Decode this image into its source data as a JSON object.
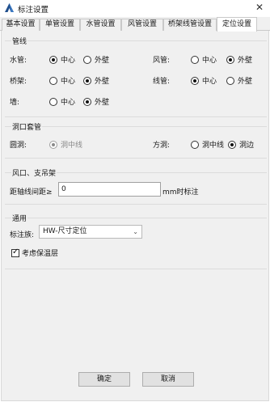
{
  "window": {
    "title": "标注设置",
    "close_label": "✕"
  },
  "tabs": [
    {
      "label": "基本设置"
    },
    {
      "label": "单管设置"
    },
    {
      "label": "水管设置"
    },
    {
      "label": "风管设置"
    },
    {
      "label": "桥架线管设置"
    },
    {
      "label": "定位设置"
    }
  ],
  "active_tab": "定位设置",
  "pipeline": {
    "title": "管线",
    "water": {
      "label": "水管:",
      "opt1": "中心",
      "opt2": "外壁",
      "selected": "中心"
    },
    "duct": {
      "label": "风管:",
      "opt1": "中心",
      "opt2": "外壁",
      "selected": "外壁"
    },
    "tray": {
      "label": "桥架:",
      "opt1": "中心",
      "opt2": "外壁",
      "selected": "外壁"
    },
    "conduit": {
      "label": "线管:",
      "opt1": "中心",
      "opt2": "外壁",
      "selected": "中心"
    },
    "wall": {
      "label": "墙:",
      "opt1": "中心",
      "opt2": "外壁",
      "selected": "外壁"
    }
  },
  "openings": {
    "title": "洞口套管",
    "round": {
      "label": "圆洞:",
      "opt1": "洞中线",
      "selected": "洞中线"
    },
    "square": {
      "label": "方洞:",
      "opt1": "洞中线",
      "opt2": "洞边",
      "selected": "洞边"
    }
  },
  "support": {
    "title": "风口、支吊架",
    "label": "距轴线间距≥",
    "value": "0",
    "suffix": "mm时标注"
  },
  "general": {
    "title": "通用",
    "style_label": "标注族:",
    "style_value": "HW-尺寸定位",
    "insulation_label": "考虑保温层",
    "insulation_checked": true
  },
  "buttons": {
    "ok": "确定",
    "cancel": "取消"
  },
  "colors": {
    "radio_disabled": "#8a8a8a",
    "accent": "#2b5797"
  }
}
